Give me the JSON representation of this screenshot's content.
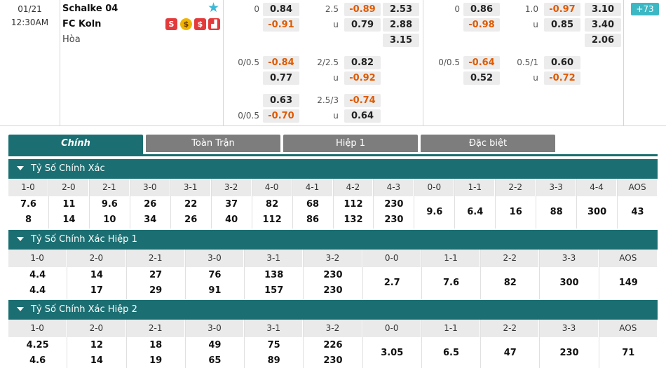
{
  "match": {
    "date": "01/21",
    "time": "12:30AM",
    "home": "Schalke 04",
    "away": "FC Koln",
    "draw": "Hòa",
    "more_count": "73",
    "rows1": {
      "hdp_line": "0",
      "hdp_home": "0.84",
      "hdp_away": "-0.91",
      "ou_line": "2.5",
      "ou_over": "-0.89",
      "ou_u": "u",
      "ou_under": "0.79",
      "x12_home": "2.53",
      "x12_away": "2.88",
      "x12_draw": "3.15",
      "h1_hdp_line": "0",
      "h1_hdp_home": "0.86",
      "h1_hdp_away": "-0.98",
      "h1_ou_line": "1.0",
      "h1_ou_over": "-0.97",
      "h1_ou_u": "u",
      "h1_ou_under": "0.85",
      "h1_x12_home": "3.10",
      "h1_x12_away": "3.40",
      "h1_x12_draw": "2.06"
    },
    "rows2": {
      "hdp_line": "0/0.5",
      "hdp_home": "-0.84",
      "hdp_away": "0.77",
      "ou_line": "2/2.5",
      "ou_over": "0.82",
      "ou_u": "u",
      "ou_under": "-0.92",
      "h1_hdp_line": "0/0.5",
      "h1_hdp_home": "-0.64",
      "h1_hdp_away": "0.52",
      "h1_ou_line": "0.5/1",
      "h1_ou_over": "0.60",
      "h1_ou_u": "u",
      "h1_ou_under": "-0.72"
    },
    "rows3": {
      "hdp_home": "0.63",
      "hdp_line": "0/0.5",
      "hdp_away": "-0.70",
      "ou_line": "2.5/3",
      "ou_over": "-0.74",
      "ou_u": "u",
      "ou_under": "0.64"
    }
  },
  "tabs": [
    "Chính",
    "Toàn Trận",
    "Hiệp 1",
    "Đặc biệt"
  ],
  "sections": [
    {
      "title": "Tỷ Số Chính Xác",
      "headers": [
        "1-0",
        "2-0",
        "2-1",
        "3-0",
        "3-1",
        "3-2",
        "4-0",
        "4-1",
        "4-2",
        "4-3",
        "0-0",
        "1-1",
        "2-2",
        "3-3",
        "4-4",
        "AOS"
      ],
      "values": [
        [
          "7.6",
          "8"
        ],
        [
          "11",
          "14"
        ],
        [
          "9.6",
          "10"
        ],
        [
          "26",
          "34"
        ],
        [
          "22",
          "26"
        ],
        [
          "37",
          "40"
        ],
        [
          "82",
          "112"
        ],
        [
          "68",
          "86"
        ],
        [
          "112",
          "132"
        ],
        [
          "230",
          "230"
        ],
        [
          "9.6"
        ],
        [
          "6.4"
        ],
        [
          "16"
        ],
        [
          "88"
        ],
        [
          "300"
        ],
        [
          "43"
        ]
      ]
    },
    {
      "title": "Tỷ Số Chính Xác Hiệp 1",
      "headers": [
        "1-0",
        "2-0",
        "2-1",
        "3-0",
        "3-1",
        "3-2",
        "0-0",
        "1-1",
        "2-2",
        "3-3",
        "AOS"
      ],
      "values": [
        [
          "4.4",
          "4.4"
        ],
        [
          "14",
          "17"
        ],
        [
          "27",
          "29"
        ],
        [
          "76",
          "91"
        ],
        [
          "138",
          "157"
        ],
        [
          "230",
          "230"
        ],
        [
          "2.7"
        ],
        [
          "7.6"
        ],
        [
          "82"
        ],
        [
          "300"
        ],
        [
          "149"
        ]
      ]
    },
    {
      "title": "Tỷ Số Chính Xác Hiệp 2",
      "headers": [
        "1-0",
        "2-0",
        "2-1",
        "3-0",
        "3-1",
        "3-2",
        "0-0",
        "1-1",
        "2-2",
        "3-3",
        "AOS"
      ],
      "values": [
        [
          "4.25",
          "4.6"
        ],
        [
          "12",
          "14"
        ],
        [
          "18",
          "19"
        ],
        [
          "49",
          "65"
        ],
        [
          "75",
          "89"
        ],
        [
          "226",
          "230"
        ],
        [
          "3.05"
        ],
        [
          "6.5"
        ],
        [
          "47"
        ],
        [
          "230"
        ],
        [
          "71"
        ]
      ]
    }
  ]
}
